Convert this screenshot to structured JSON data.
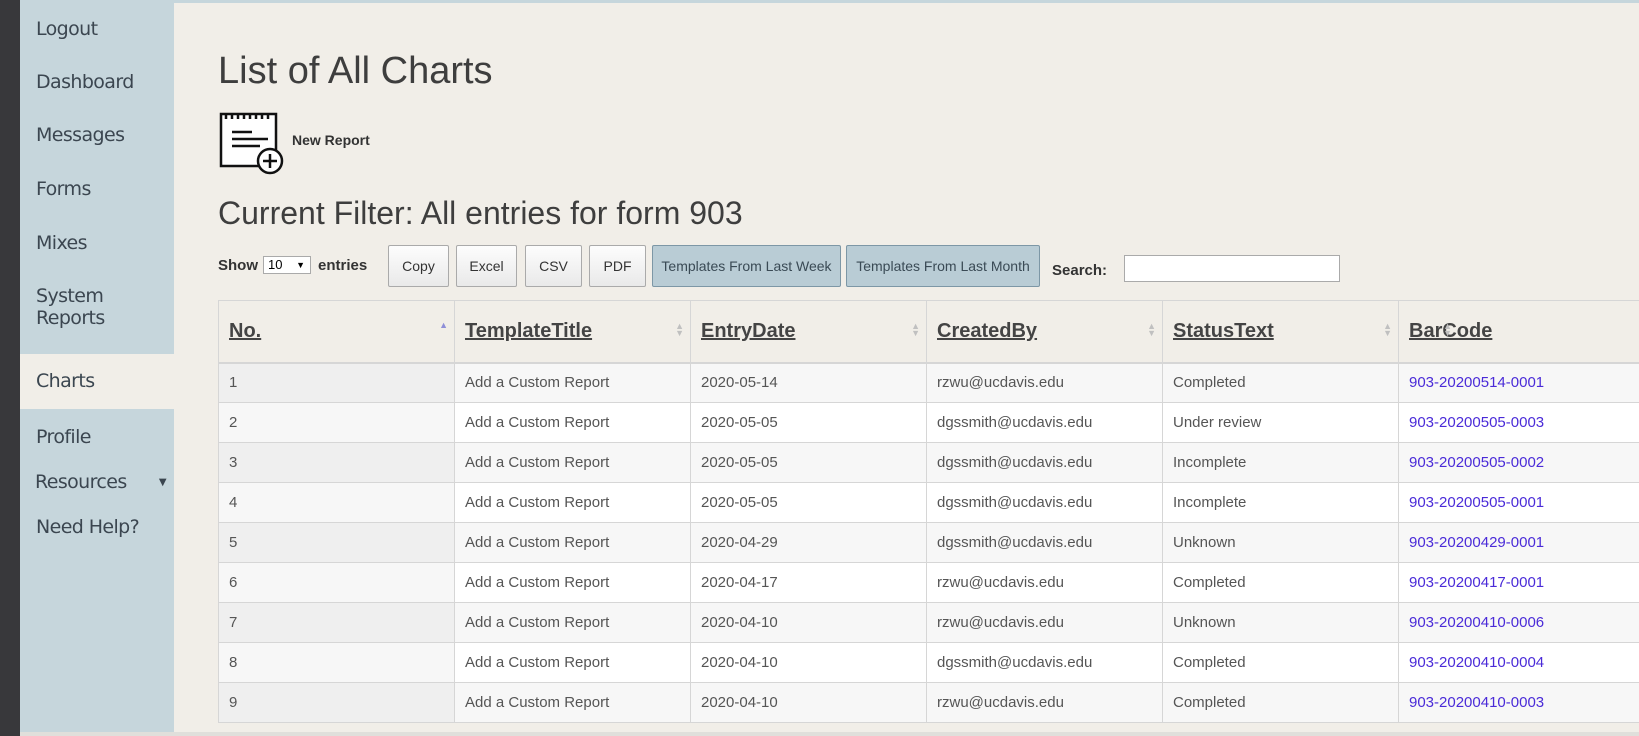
{
  "sidebar": {
    "items": [
      {
        "label": "Logout"
      },
      {
        "label": "Dashboard"
      },
      {
        "label": "Messages"
      },
      {
        "label": "Forms"
      },
      {
        "label": "Mixes"
      },
      {
        "label": "System Reports"
      },
      {
        "label": "Charts",
        "active": true
      },
      {
        "label": "Profile"
      },
      {
        "label": "Resources",
        "caret": "▼"
      },
      {
        "label": "Need Help?"
      }
    ]
  },
  "main": {
    "title": "List of All Charts",
    "new_report_label": "New Report",
    "filter_title": "Current Filter: All entries for form 903"
  },
  "controls": {
    "show_label": "Show",
    "page_size": "10",
    "entries_label": "entries",
    "buttons": {
      "copy": "Copy",
      "excel": "Excel",
      "csv": "CSV",
      "pdf": "PDF",
      "last_week": "Templates From Last Week",
      "last_month": "Templates From Last Month"
    },
    "search_label": "Search:",
    "search_value": ""
  },
  "table": {
    "columns": [
      "No.",
      "TemplateTitle",
      "EntryDate",
      "CreatedBy",
      "StatusText",
      "BarCode"
    ],
    "rows": [
      [
        "1",
        "Add a Custom Report",
        "2020-05-14",
        "rzwu@ucdavis.edu",
        "Completed",
        "903-20200514-0001"
      ],
      [
        "2",
        "Add a Custom Report",
        "2020-05-05",
        "dgssmith@ucdavis.edu",
        "Under review",
        "903-20200505-0003"
      ],
      [
        "3",
        "Add a Custom Report",
        "2020-05-05",
        "dgssmith@ucdavis.edu",
        "Incomplete",
        "903-20200505-0002"
      ],
      [
        "4",
        "Add a Custom Report",
        "2020-05-05",
        "dgssmith@ucdavis.edu",
        "Incomplete",
        "903-20200505-0001"
      ],
      [
        "5",
        "Add a Custom Report",
        "2020-04-29",
        "dgssmith@ucdavis.edu",
        "Unknown",
        "903-20200429-0001"
      ],
      [
        "6",
        "Add a Custom Report",
        "2020-04-17",
        "rzwu@ucdavis.edu",
        "Completed",
        "903-20200417-0001"
      ],
      [
        "7",
        "Add a Custom Report",
        "2020-04-10",
        "rzwu@ucdavis.edu",
        "Unknown",
        "903-20200410-0006"
      ],
      [
        "8",
        "Add a Custom Report",
        "2020-04-10",
        "dgssmith@ucdavis.edu",
        "Completed",
        "903-20200410-0004"
      ],
      [
        "9",
        "Add a Custom Report",
        "2020-04-10",
        "rzwu@ucdavis.edu",
        "Completed",
        "903-20200410-0003"
      ]
    ]
  },
  "colors": {
    "sidebar_bg": "#c6d6dc",
    "page_bg": "#f1eee8",
    "link": "#4a2bd8",
    "blue_button": "#b9ccd5"
  }
}
